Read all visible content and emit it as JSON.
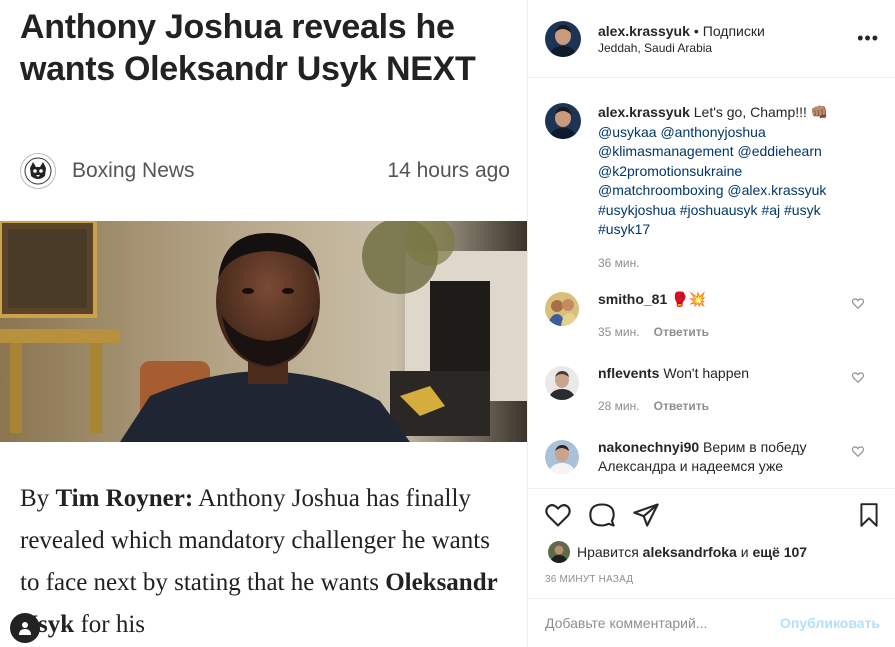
{
  "article": {
    "headline": "Anthony Joshua reveals he wants Oleksandr Usyk NEXT",
    "source": "Boxing News",
    "time": "14 hours ago",
    "body_prefix": "By ",
    "author": "Tim Royner:",
    "body_1": " Anthony Joshua has finally revealed which mandatory challenger he wants to face next by stating that he wants ",
    "body_name": "Oleksandr Usyk",
    "body_2": " for his"
  },
  "post": {
    "username": "alex.krassyuk",
    "separator": "•",
    "follow_label": "Подписки",
    "location": "Jeddah, Saudi Arabia",
    "more_icon": "more-horizontal-icon"
  },
  "caption": {
    "username": "alex.krassyuk",
    "text": "Let's go, Champ!!! 👊🏽",
    "tags": [
      "@usykaa",
      "@anthonyjoshua",
      "@klimasmanagement",
      "@eddiehearn",
      "@k2promotionsukraine",
      "@matchroomboxing",
      "@alex.krassyuk",
      "#usykjoshua",
      "#joshuausyk",
      "#aj",
      "#usyk",
      "#usyk17"
    ],
    "time": "36 мин."
  },
  "comments": [
    {
      "username": "smitho_81",
      "text": "🥊💥",
      "time": "35 мин.",
      "reply": "Ответить"
    },
    {
      "username": "nflevents",
      "text": "Won't happen",
      "time": "28 мин.",
      "reply": "Ответить"
    },
    {
      "username": "nakonechnyi90",
      "text": "Верим в победу Александра и надеемся уже",
      "time": "",
      "reply": ""
    }
  ],
  "likes": {
    "prefix": "Нравится",
    "user": "aleksandrfoka",
    "middle": "и",
    "rest": "ещё 107"
  },
  "timestamp": "36 МИНУТ НАЗАД",
  "add_comment": {
    "placeholder": "Добавьте комментарий...",
    "publish_label": "Опубликовать"
  },
  "colors": {
    "link": "#00376b",
    "muted": "#8e8e8e",
    "publish_disabled": "#b2dffc",
    "border": "#efefef"
  }
}
